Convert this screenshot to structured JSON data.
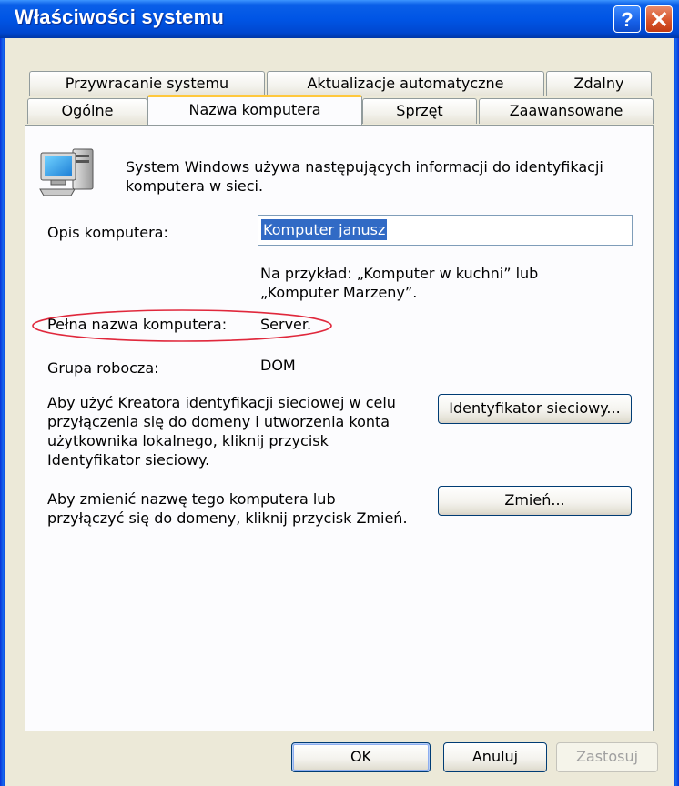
{
  "window": {
    "title": "Właściwości systemu"
  },
  "tabs": {
    "row1": [
      "Przywracanie systemu",
      "Aktualizacje automatyczne",
      "Zdalny"
    ],
    "row2": [
      "Ogólne",
      "Nazwa komputera",
      "Sprzęt",
      "Zaawansowane"
    ],
    "active": "Nazwa komputera"
  },
  "content": {
    "intro_line1": "System Windows używa następujących informacji do identyfikacji",
    "intro_line2": "komputera w sieci.",
    "description_label": "Opis komputera:",
    "description_value": "Komputer janusz",
    "example_line1": "Na przykład: „Komputer w kuchni” lub",
    "example_line2": "„Komputer Marzeny”.",
    "full_name_label": "Pełna nazwa komputera:",
    "full_name_value": "Server.",
    "workgroup_label": "Grupa robocza:",
    "workgroup_value": "DOM",
    "network_id_text": [
      "Aby użyć Kreatora identyfikacji sieciowej w celu",
      "przyłączenia się do domeny i utworzenia konta",
      "użytkownika lokalnego, kliknij przycisk",
      "Identyfikator sieciowy."
    ],
    "network_id_button": "Identyfikator sieciowy...",
    "rename_text": [
      "Aby zmienić nazwę tego komputera lub",
      "przyłączyć się do domeny, kliknij przycisk Zmień."
    ],
    "rename_button": "Zmień..."
  },
  "footer": {
    "ok": "OK",
    "cancel": "Anuluj",
    "apply": "Zastosuj"
  },
  "colors": {
    "titlebar": "#0055E5",
    "dialog_bg": "#ECE9D8",
    "selection": "#316AC5",
    "highlight_ellipse": "#E0283C",
    "active_tab_accent": "#FFC83C"
  }
}
